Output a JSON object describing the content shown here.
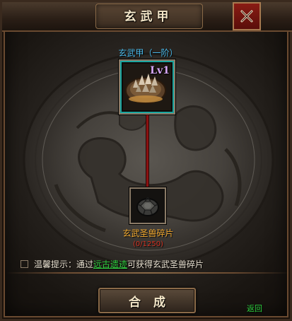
{
  "window": {
    "title": "玄武甲",
    "close_icon": "close-icon"
  },
  "item": {
    "name": "玄武甲（一阶）",
    "level_badge": "Lv1",
    "icon": "turtle-armor-icon"
  },
  "material": {
    "name": "玄武圣兽碎片",
    "count": "(0/1250)",
    "icon": "turtle-shell-fragment-icon"
  },
  "tip": {
    "prefix": "温馨提示：通过",
    "link": "远古遗迹",
    "suffix": "可获得玄武圣兽碎片"
  },
  "actions": {
    "compose_label": "合成",
    "back_label": "返回"
  },
  "colors": {
    "item_name": "#4ab8e8",
    "material_name": "#f0a830",
    "count": "#d03020",
    "link": "#30d040",
    "close_button": "#8a1c14"
  }
}
